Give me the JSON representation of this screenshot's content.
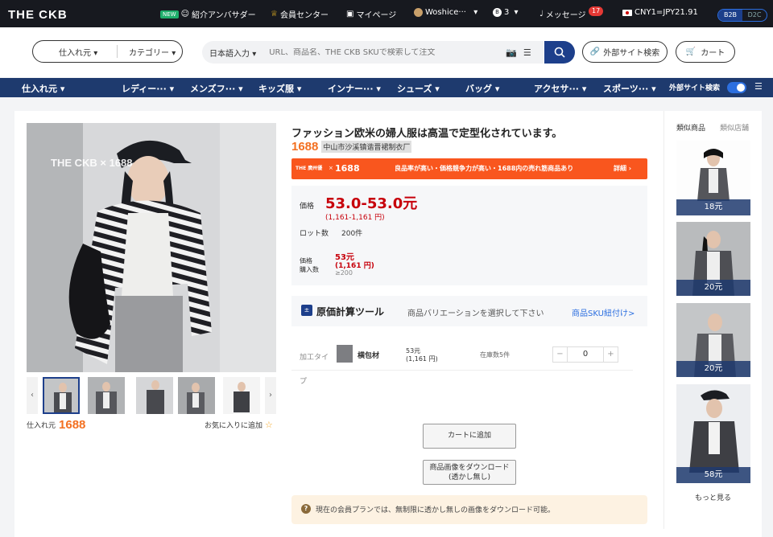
{
  "topbar": {
    "logo": "THE CKB",
    "new_tag": "NEW",
    "ambassador": "紹介アンバサダー",
    "member_center": "会員センター",
    "my_page": "マイページ",
    "user": "Woshice···",
    "points": "3",
    "messages": "メッセージ",
    "message_count": "17",
    "currency": "CNY1=JPY21.91",
    "b2b": "B2B",
    "d2c": "D2C"
  },
  "search": {
    "source_label": "仕入れ元",
    "category_label": "カテゴリー",
    "lang": "日本語入力",
    "placeholder": "URL、商品名、THE CKB SKUで検索して注文",
    "external_search": "外部サイト検索",
    "cart": "カート"
  },
  "nav": {
    "items": [
      "仕入れ元",
      "レディー···",
      "メンズフ···",
      "キッズ服",
      "インナー···",
      "シューズ",
      "バッグ",
      "アクセサ···",
      "スポーツ···"
    ],
    "external": "外部サイト検索"
  },
  "product": {
    "title": "ファッション欧米の婦人服は高温で定型化されています。",
    "source": "1688",
    "supplier": "中山市沙溪镇谐晋裙制衣厂",
    "watermark": "THE CKB × 1688",
    "banner_brand": "THE 廣州優",
    "banner_x": "×",
    "banner_1688": "1688",
    "banner_text": "良品率が高い・価格競争力が高い・1688内の売れ筋商品あり",
    "banner_detail": "詳細",
    "price_label": "価格",
    "price": "53.0-53.0元",
    "price_jpy": "(1,161-1,161 円)",
    "lot_label": "ロット数",
    "lot": "200件",
    "tier_label1": "価格",
    "tier_label2": "購入数",
    "tier_price": "53元",
    "tier_jpy": "(1,161 円)",
    "tier_qty": "≥200",
    "calc_title": "原価計算ツール",
    "calc_hint": "商品バリエーションを選択して下さい",
    "calc_link": "商品SKU紐付け>",
    "variant_label": "加工タイ",
    "variant_label2": "プ",
    "variant_name": "横包材",
    "variant_price": "53元",
    "variant_jpy": "(1,161 円)",
    "stock": "在庫数5件",
    "qty": "0",
    "minus": "−",
    "plus": "+",
    "add_cart": "カートに追加",
    "download_line1": "商品画像をダウンロード",
    "download_line2": "(透かし無し)",
    "notice": "現在の会員プランでは、無制限に透かし無しの画像をダウンロード可能。",
    "source_label": "仕入れ元",
    "source_name": "1688",
    "favorite": "お気に入りに追加"
  },
  "side": {
    "tab1": "類似商品",
    "tab2": "類似店舗",
    "prices": [
      "18元",
      "20元",
      "20元",
      "58元"
    ],
    "more": "もっと見る"
  },
  "colors": {
    "dark": "#17191f",
    "navy": "#1e3a6e",
    "orange": "#f37021",
    "price_red": "#c7000b"
  }
}
